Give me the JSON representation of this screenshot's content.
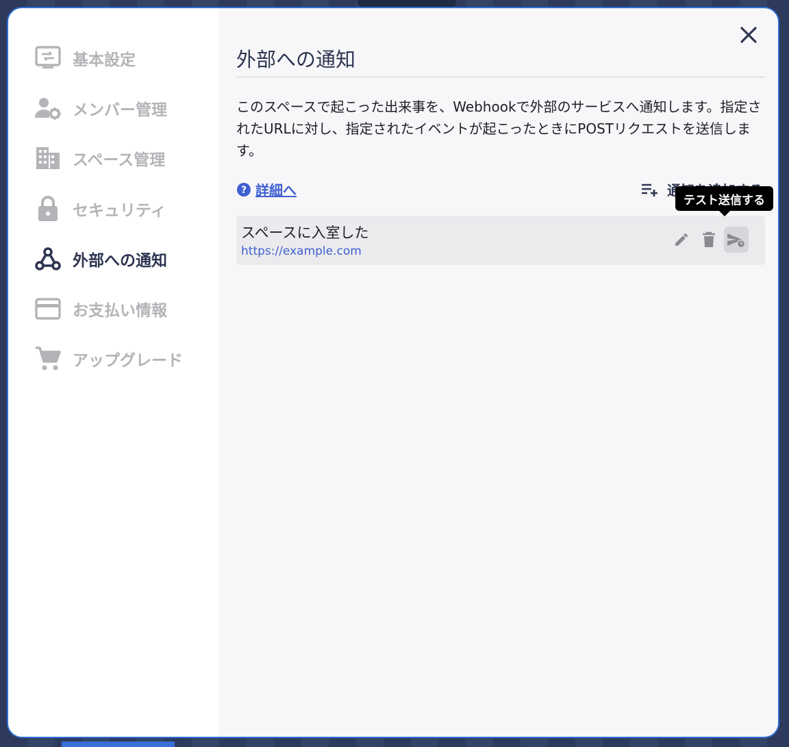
{
  "sidebar": {
    "items": [
      {
        "id": "basic",
        "label": "基本設定",
        "icon": "settings-panel-icon",
        "active": false
      },
      {
        "id": "members",
        "label": "メンバー管理",
        "icon": "user-gear-icon",
        "active": false
      },
      {
        "id": "space",
        "label": "スペース管理",
        "icon": "building-icon",
        "active": false
      },
      {
        "id": "security",
        "label": "セキュリティ",
        "icon": "lock-icon",
        "active": false
      },
      {
        "id": "webhook",
        "label": "外部への通知",
        "icon": "webhook-icon",
        "active": true
      },
      {
        "id": "billing",
        "label": "お支払い情報",
        "icon": "credit-card-icon",
        "active": false
      },
      {
        "id": "upgrade",
        "label": "アップグレード",
        "icon": "cart-icon",
        "active": false
      }
    ]
  },
  "main": {
    "title": "外部への通知",
    "description": "このスペースで起こった出来事を、Webhookで外部のサービスへ通知します。指定されたURLに対し、指定されたイベントが起こったときにPOSTリクエストを送信します。",
    "help_link": "詳細へ",
    "add_label": "通知を追加する",
    "webhooks": [
      {
        "name": "スペースに入室した",
        "url": "https://example.com"
      }
    ],
    "tooltip": "テスト送信する"
  },
  "colors": {
    "accent": "#3f5fd0",
    "modal_border": "#2f6fd6",
    "active_text": "#2e3550",
    "inactive_text": "#b4b4b8"
  }
}
